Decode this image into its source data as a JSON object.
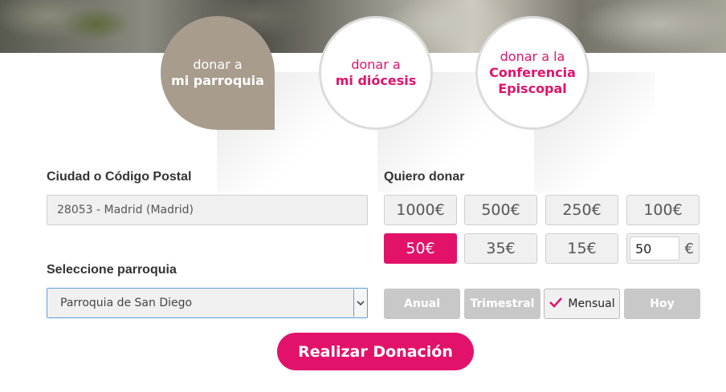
{
  "tabs": [
    {
      "line1": "donar a",
      "line2": "mi parroquia",
      "active": true
    },
    {
      "line1": "donar a",
      "line2": "mi diócesis",
      "active": false
    },
    {
      "line1": "donar a la",
      "line2": "Conferencia",
      "line3": "Episcopal",
      "active": false
    }
  ],
  "location": {
    "label": "Ciudad o Código Postal",
    "value": "28053 - Madrid (Madrid)"
  },
  "parish": {
    "label": "Seleccione parroquia",
    "selected": "Parroquia de San Diego"
  },
  "donation": {
    "label": "Quiero donar",
    "amounts": [
      "1000€",
      "500€",
      "250€",
      "100€",
      "50€",
      "35€",
      "15€"
    ],
    "selected_amount": "50€",
    "custom_value": "50",
    "currency_symbol": "€"
  },
  "frequency": {
    "options": [
      "Anual",
      "Trimestral",
      "Mensual",
      "Hoy"
    ],
    "selected": "Mensual"
  },
  "submit_label": "Realizar Donación",
  "colors": {
    "accent": "#e2126a",
    "tab_active_bg": "#a89c8d",
    "disabled_bg": "#c8c8c8"
  },
  "icons": {
    "check": "check-icon",
    "dropdown": "chevron-down-icon"
  }
}
